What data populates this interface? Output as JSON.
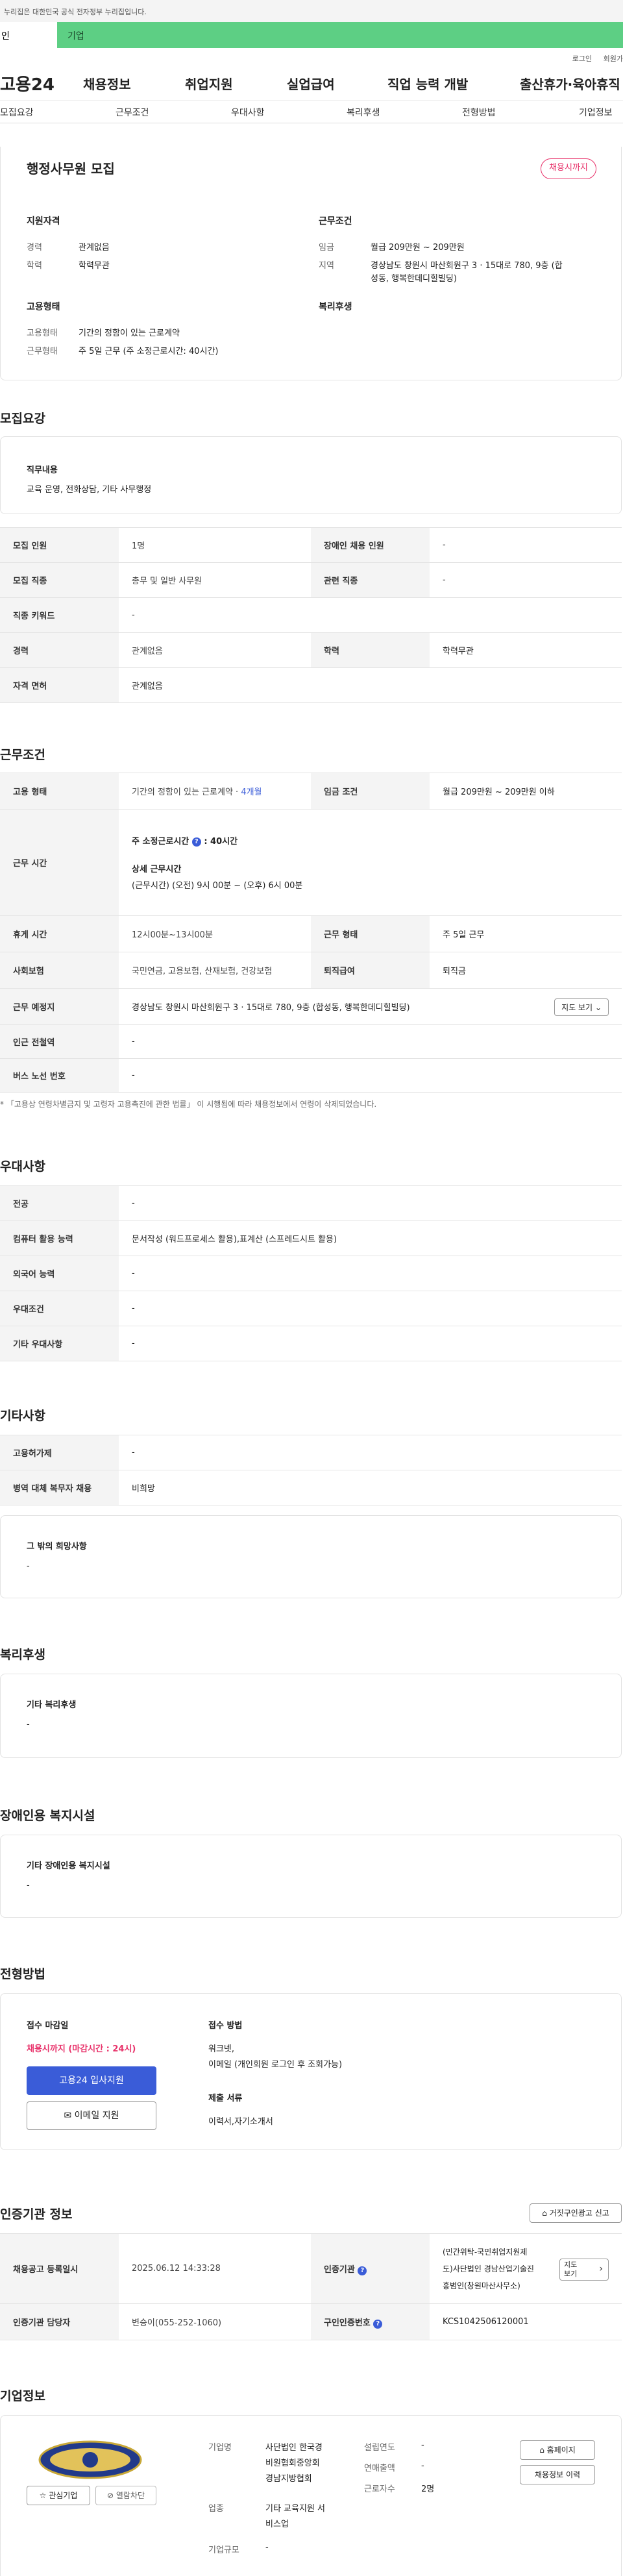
{
  "banner": {
    "text": "누리집은 대한민국 공식 전자정부 누리집입니다."
  },
  "member_tabs": {
    "personal": "인",
    "company": "기업"
  },
  "util": {
    "login": "로그인",
    "join": "회원가"
  },
  "gnb": {
    "logo": "고용24",
    "items": [
      "채용정보",
      "취업지원",
      "실업급여",
      "직업 능력 개발",
      "출산휴가·육아휴직"
    ]
  },
  "subnav": [
    "모집요강",
    "근무조건",
    "우대사항",
    "복리후생",
    "전형방법",
    "기업정보"
  ],
  "summary": {
    "title": "행정사무원 모집",
    "badge": "채용시까지",
    "qual_title": "지원자격",
    "qual": [
      {
        "k": "경력",
        "v": "관계없음"
      },
      {
        "k": "학력",
        "v": "학력무관"
      }
    ],
    "cond_title": "근무조건",
    "pay_k": "임금",
    "pay_v": "월급 209만원 ~ 209만원",
    "loc_k": "지역",
    "loc_v1": "경상남도 창원시 마산회원구 3 · 15대로 780, 9층 (합",
    "loc_v2": "성동, 행복한데디힐빌딩)",
    "emp_title": "고용형태",
    "emp": [
      {
        "k": "고용형태",
        "v": "기간의 정함이 있는 근로계약"
      },
      {
        "k": "근무형태",
        "v": "주 5일 근무 (주 소정근로시간: 40시간)"
      }
    ],
    "welfare_title": "복리후생"
  },
  "recruit": {
    "heading": "모집요강",
    "duty_title": "직무내용",
    "duty_text": "교육 운영, 전화상담, 기타 사무행정",
    "rows": [
      {
        "k1": "모집 인원",
        "v1": "1명",
        "k2": "장애인 채용 인원",
        "v2": "-"
      },
      {
        "k1": "모집 직종",
        "v1": "총무 및 일반 사무원",
        "k2": "관련 직종",
        "v2": "-"
      },
      {
        "k1": "직종 키워드",
        "v1": "-"
      },
      {
        "k1": "경력",
        "v1": "관계없음",
        "k2": "학력",
        "v2": "학력무관"
      },
      {
        "k1": "자격 면허",
        "v1": "관계없음"
      }
    ]
  },
  "work": {
    "heading": "근무조건",
    "emp_k": "고용 형태",
    "emp_v": "기간의 정함이 있는 근로계약 · ",
    "emp_link": "4개월",
    "pay_k": "임금 조건",
    "pay_v": "월급 209만원 ~ 209만원 이하",
    "time_k": "근무 시간",
    "time_main": "주 소정근로시간",
    "time_hours": ": 40시간",
    "time_detail_title": "상세 근무시간",
    "time_detail": "(근무시간) (오전) 9시 00분 ~ (오후) 6시 00분",
    "break_k": "휴게 시간",
    "break_v": "12시00분~13시00분",
    "form_k": "근무 형태",
    "form_v": "주 5일 근무",
    "ins_k": "사회보험",
    "ins_v": "국민연금, 고용보험, 산재보험, 건강보험",
    "sev_k": "퇴직급여",
    "sev_v": "퇴직금",
    "place_k": "근무 예정지",
    "place_v": "경상남도 창원시 마산회원구 3 · 15대로 780, 9층 (합성동, 행복한데디힐빌딩)",
    "map_btn": "지도 보기",
    "subway_k": "인근 전철역",
    "subway_v": "-",
    "bus_k": "버스 노선 번호",
    "bus_v": "-",
    "note": "* 「고용상 연령차별금지 및 고령자 고용촉진에 관한 법률」 이 시행됨에 따라 채용정보에서 연령이 삭제되었습니다."
  },
  "prefer": {
    "heading": "우대사항",
    "rows": [
      {
        "k": "전공",
        "v": "-"
      },
      {
        "k": "컴퓨터 활용 능력",
        "v": "문서작성 (워드프로세스 활용),표계산 (스프레드시트 활용)"
      },
      {
        "k": "외국어 능력",
        "v": "-"
      },
      {
        "k": "우대조건",
        "v": "-"
      },
      {
        "k": "기타 우대사항",
        "v": "-"
      }
    ]
  },
  "etc": {
    "heading": "기타사항",
    "rows": [
      {
        "k": "고용허가제",
        "v": "-"
      },
      {
        "k": "병역 대체 복무자 채용",
        "v": "비희망"
      }
    ],
    "other_title": "그 밖의 희망사항",
    "other_v": "-"
  },
  "welfare": {
    "heading": "복리후생",
    "box_title": "기타 복리후생",
    "box_v": "-"
  },
  "disability": {
    "heading": "장애인용 복지시설",
    "box_title": "기타 장애인용 복지시설",
    "box_v": "-"
  },
  "selection": {
    "heading": "전형방법",
    "deadline_title": "접수 마감일",
    "deadline_v": "채용시까지 (마감시간 : 24시)",
    "apply_btn": "고용24 입사지원",
    "email_btn": "이메일 지원",
    "method_title": "접수 방법",
    "method_v1": "워크넷,",
    "method_v2": "이메일 (개인회원 로그인 후 조회가능)",
    "docs_title": "제출 서류",
    "docs_v": "이력서,자기소개서"
  },
  "cert": {
    "heading": "인증기관 정보",
    "report_btn": "거짓구인광고 신고",
    "reg_k": "채용공고 등록일시",
    "reg_v": "2025.06.12 14:33:28",
    "org_k": "인증기관",
    "org_v1": "(민간위탁-국민취업지원제",
    "org_v2": "도)사단법인 경남산업기술진",
    "org_v3": "흥범인(창원마산사무소)",
    "map_btn1": "지도",
    "map_btn2": "보기",
    "mgr_k": "인증기관 담당자",
    "mgr_v": "변승이(055-252-1060)",
    "no_k": "구인인증번호",
    "no_v": "KCS1042506120001"
  },
  "company": {
    "heading": "기업정보",
    "fav_btn": "관심기업",
    "block_btn": "열람차단",
    "name_k": "기업명",
    "name_v1": "사단법인 한국경",
    "name_v2": "비원협회중앙회",
    "name_v3": "경남지방협회",
    "ind_k": "업종",
    "ind_v1": "기타 교육지원 서",
    "ind_v2": "비스업",
    "size_k": "기업규모",
    "size_v": "-",
    "year_k": "설립연도",
    "year_v": "-",
    "sales_k": "연매출액",
    "sales_v": "-",
    "emp_k": "근로자수",
    "emp_v": "2명",
    "home_btn": "홈페이지",
    "history_btn": "채용정보 이력"
  },
  "colors": {
    "accent_green": "#5dcf84",
    "brand_blue": "#3a5cd8",
    "badge_pink": "#e8336b"
  }
}
